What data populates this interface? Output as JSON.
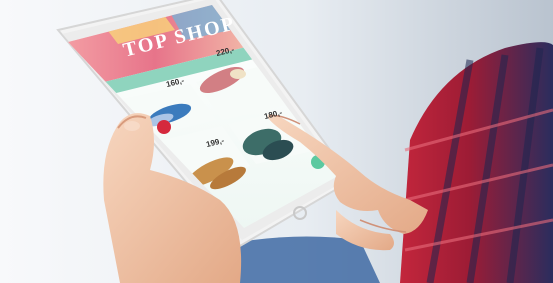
{
  "photo": {
    "subject": "hand-holding-tablet-shopping-app",
    "colors": {
      "background": "#eef1f4",
      "tablet_frame": "#f2f2f2",
      "screen_banner": "#e87d7d",
      "screen_tiles": "#9fd6c6",
      "accent_green": "#5cc9a0",
      "shirt_red": "#c0253a",
      "shirt_navy": "#1d2650",
      "skin": "#f1c7a8"
    }
  },
  "screen": {
    "banner_text": "TOP SHOP",
    "prices": [
      "220,-",
      "160,-",
      "199,-",
      "180,-"
    ]
  }
}
